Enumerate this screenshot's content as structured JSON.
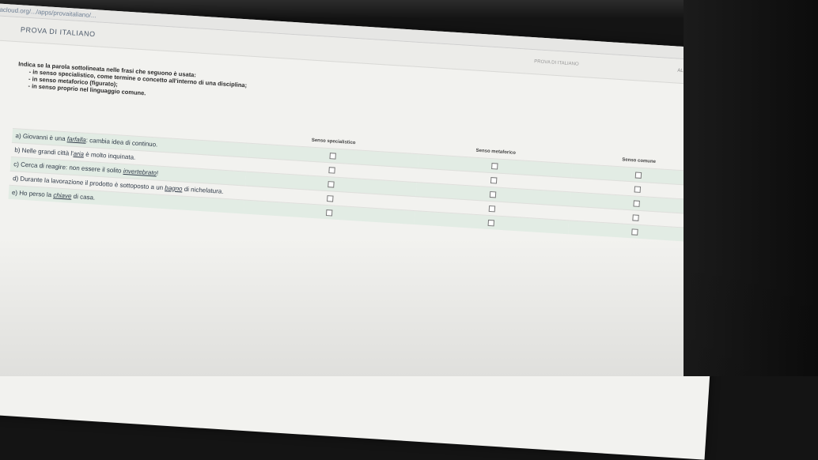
{
  "browser": {
    "url": "itacloud.org/.../apps/provaitaliano/...",
    "actions": "☆ ⤓ ⋮"
  },
  "header": {
    "logo": "PROVA DI ITALIANO",
    "timer_label": "PROVA DI ITALIANO",
    "user_label": "ALUNNO"
  },
  "question": {
    "instruction": "Indica se la parola sottolineata nelle frasi che seguono è usata:",
    "options": [
      "- in senso specialistico, come termine o concetto all'interno di una disciplina;",
      "- in senso metaforico (figurato);",
      "- in senso proprio nel linguaggio comune."
    ]
  },
  "table": {
    "columns": [
      "",
      "Senso specialistico",
      "Senso metaforico",
      "Senso comune"
    ],
    "rows": [
      {
        "prefix": "a) Giovanni è una ",
        "word": "farfalla",
        "suffix": ": cambia idea di continuo.",
        "checked": [
          false,
          false,
          false
        ]
      },
      {
        "prefix": "b) Nelle grandi città l'",
        "word": "aria",
        "suffix": " è molto inquinata.",
        "checked": [
          false,
          false,
          false
        ]
      },
      {
        "prefix": "c) Cerca di reagire: non essere il solito ",
        "word": "invertebrato",
        "suffix": "!",
        "checked": [
          false,
          false,
          false
        ]
      },
      {
        "prefix": "d) Durante la lavorazione il prodotto è sottoposto a un ",
        "word": "bagno",
        "suffix": " di nichelatura.",
        "checked": [
          false,
          false,
          false
        ]
      },
      {
        "prefix": "e) Ho perso la ",
        "word": "chiave",
        "suffix": " di casa.",
        "checked": [
          false,
          false,
          false
        ]
      }
    ]
  }
}
